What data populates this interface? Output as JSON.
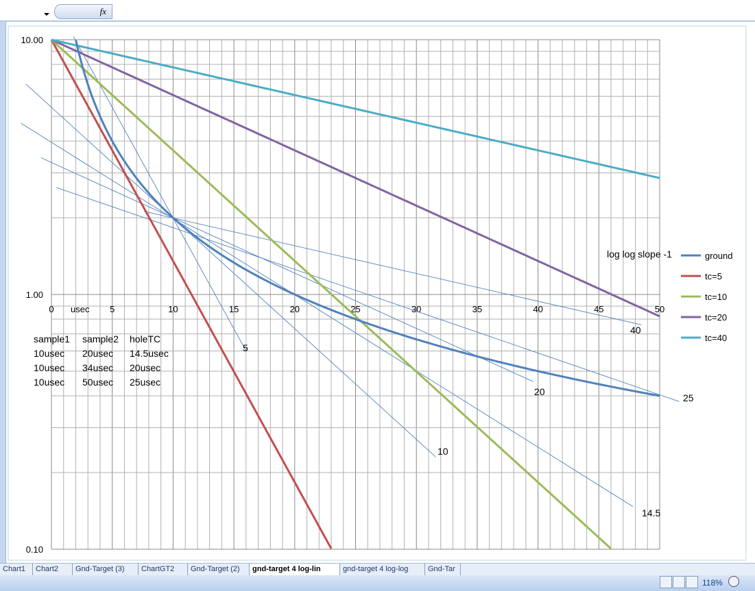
{
  "formula_bar": {
    "fx_label": "fx"
  },
  "chart_data": {
    "type": "line",
    "x_ticks": [
      "0",
      "5",
      "10",
      "15",
      "20",
      "25",
      "30",
      "35",
      "40",
      "45",
      "50"
    ],
    "x_unit_label": "usec",
    "xlim": [
      0,
      50
    ],
    "y_scale": "log",
    "ylim": [
      0.1,
      10
    ],
    "y_ticks": [
      "10.00",
      "1.00",
      "0.10"
    ],
    "grid": true,
    "legend_title": "log log slope -1",
    "legend_placement": "right",
    "series": [
      {
        "name": "ground",
        "color": "#4f81bd",
        "x": [
          2,
          2.5,
          3,
          3.5,
          4,
          5,
          6,
          7,
          8,
          10,
          12,
          15,
          20,
          25,
          30,
          35,
          40,
          45,
          50
        ],
        "y": [
          10,
          8,
          6.67,
          5.71,
          5,
          4,
          3.33,
          2.86,
          2.5,
          2,
          1.67,
          1.33,
          1,
          0.8,
          0.67,
          0.57,
          0.5,
          0.44,
          0.4
        ]
      },
      {
        "name": "tc=5",
        "color": "#c0504d",
        "x": [
          0,
          5,
          10,
          15,
          20,
          23
        ],
        "y": [
          10,
          3.68,
          1.35,
          0.5,
          0.18,
          0.1
        ]
      },
      {
        "name": "tc=10",
        "color": "#9bbb59",
        "x": [
          0,
          10,
          20,
          30,
          40,
          46
        ],
        "y": [
          10,
          3.68,
          1.35,
          0.5,
          0.18,
          0.1
        ]
      },
      {
        "name": "tc=20",
        "color": "#8064a2",
        "x": [
          0,
          10,
          20,
          30,
          40,
          50
        ],
        "y": [
          10,
          6.07,
          3.68,
          2.23,
          1.35,
          0.82
        ]
      },
      {
        "name": "tc=40",
        "color": "#4bacc6",
        "x": [
          0,
          10,
          20,
          30,
          40,
          50
        ],
        "y": [
          10,
          7.79,
          6.07,
          4.72,
          3.68,
          2.87
        ]
      }
    ],
    "tangent_lines": [
      {
        "label": "5",
        "x": [
          1.8,
          16
        ],
        "y": [
          10.3,
          0.6
        ]
      },
      {
        "label": "10",
        "x": [
          -2.1,
          31.6
        ],
        "y": [
          6.7,
          0.23
        ]
      },
      {
        "label": "14.5",
        "x": [
          -2.5,
          47.8
        ],
        "y": [
          4.7,
          0.147
        ]
      },
      {
        "label": "20",
        "x": [
          -0.85,
          39.6
        ],
        "y": [
          3.44,
          0.455
        ]
      },
      {
        "label": "25",
        "x": [
          0.4,
          51.6
        ],
        "y": [
          2.63,
          0.38
        ]
      },
      {
        "label": "40",
        "x": [
          7.6,
          48.5
        ],
        "y": [
          2.12,
          0.76
        ]
      }
    ],
    "table": {
      "headers": [
        "sample1",
        "sample2",
        "holeTC"
      ],
      "rows": [
        [
          "10usec",
          "20usec",
          "14.5usec"
        ],
        [
          "10usec",
          "34usec",
          "20usec"
        ],
        [
          "10usec",
          "50usec",
          "25usec"
        ]
      ]
    }
  },
  "sheet_tabs": [
    {
      "label": "Chart1"
    },
    {
      "label": "Chart2"
    },
    {
      "label": "Gnd-Target (3)"
    },
    {
      "label": "ChartGT2"
    },
    {
      "label": "Gnd-Target (2)"
    },
    {
      "label": "gnd-target 4 log-lin",
      "active": true
    },
    {
      "label": "gnd-target 4 log-log"
    },
    {
      "label": "Gnd-Tar"
    }
  ],
  "status": {
    "zoom": "118%"
  }
}
